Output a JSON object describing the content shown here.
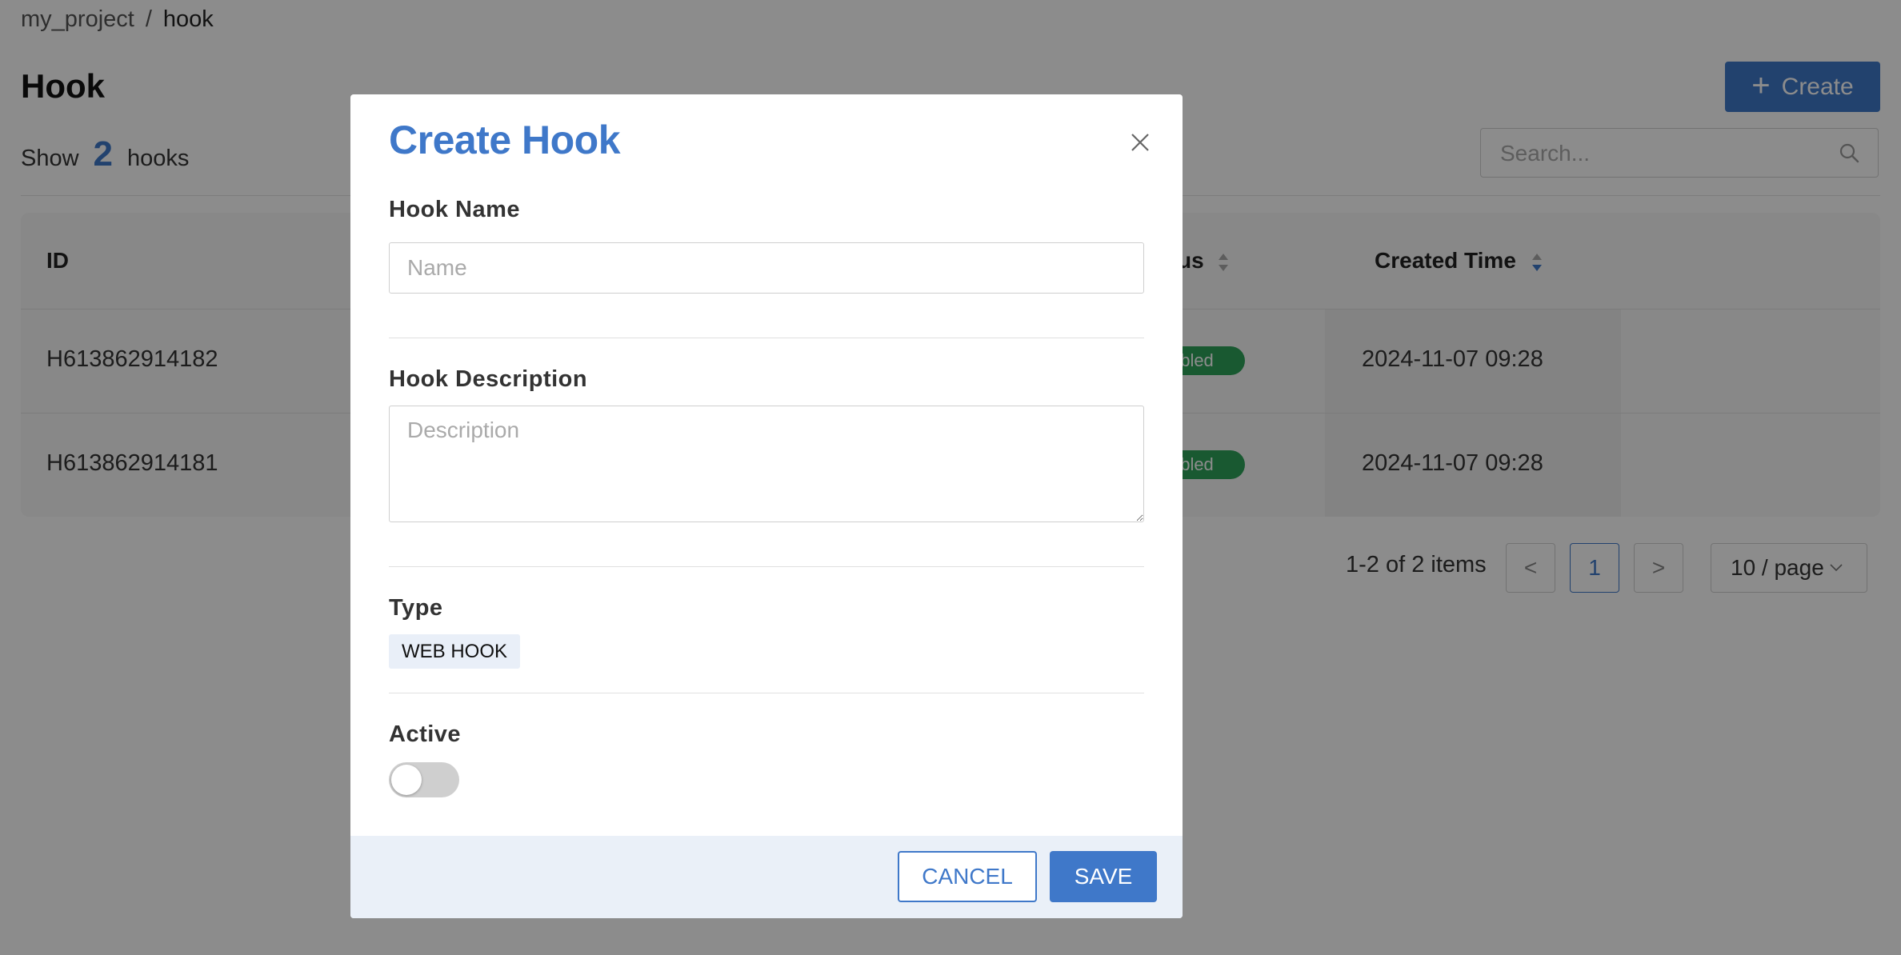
{
  "breadcrumb": {
    "project": "my_project",
    "separator": "/",
    "current": "hook"
  },
  "page": {
    "title": "Hook",
    "create_label": "Create",
    "show_prefix": "Show",
    "count": "2",
    "show_suffix": "hooks",
    "search_placeholder": "Search..."
  },
  "table": {
    "columns": {
      "id": "ID",
      "status": "us",
      "created_time": "Created Time"
    },
    "rows": [
      {
        "id": "H613862914182",
        "status": "bled",
        "created_time": "2024-11-07 09:28"
      },
      {
        "id": "H613862914181",
        "status": "bled",
        "created_time": "2024-11-07 09:28"
      }
    ]
  },
  "pagination": {
    "info": "1-2 of 2 items",
    "prev": "<",
    "current_page": "1",
    "next": ">",
    "page_size": "10 / page"
  },
  "modal": {
    "title": "Create Hook",
    "name_label": "Hook Name",
    "name_placeholder": "Name",
    "description_label": "Hook Description",
    "description_placeholder": "Description",
    "type_label": "Type",
    "type_value": "WEB HOOK",
    "active_label": "Active",
    "active_on": false,
    "cancel_label": "CANCEL",
    "save_label": "SAVE"
  },
  "colors": {
    "accent": "#3f78c9",
    "badge_green": "#2ea35a",
    "footer_bg": "#eaf0f8",
    "tag_bg": "#e9eff8"
  }
}
